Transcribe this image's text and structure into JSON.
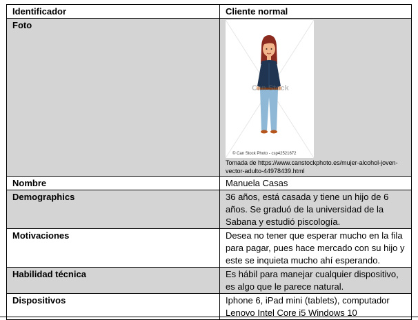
{
  "table": {
    "header": {
      "label": "Identificador",
      "value": "Cliente normal"
    },
    "photo": {
      "label": "Foto",
      "watermark": "Can Stock",
      "credit": "© Can Stock Photo - csp42521672",
      "caption": "Tomada de https://www.canstockphoto.es/mujer-alcohol-joven-vector-adulto-44978439.html"
    },
    "nombre": {
      "label": "Nombre",
      "value": "Manuela Casas"
    },
    "demographics": {
      "label": "Demographics",
      "value": "36 años, está casada y tiene un hijo de 6 años. Se graduó de la universidad de la Sabana y estudió piscología."
    },
    "motivaciones": {
      "label": "Motivaciones",
      "value": "Desea no tener que esperar mucho en la fila para pagar, pues hace mercado con su hijo y este se inquieta mucho ahí esperando."
    },
    "habilidad": {
      "label": "Habilidad técnica",
      "value": "Es hábil para manejar cualquier dispositivo, es algo que le parece natural."
    },
    "dispositivos": {
      "label": "Dispositivos",
      "value": "Iphone 6, iPad mini (tablets), computador Lenovo Intel Core i5 Windows 10"
    }
  },
  "colors": {
    "row_shade": "#d4d4d4",
    "border": "#000000",
    "hair": "#8b2a1e",
    "jacket": "#1f3552",
    "jeans": "#8fb8d6",
    "shoes": "#b5541b",
    "skin": "#f2b48a"
  }
}
